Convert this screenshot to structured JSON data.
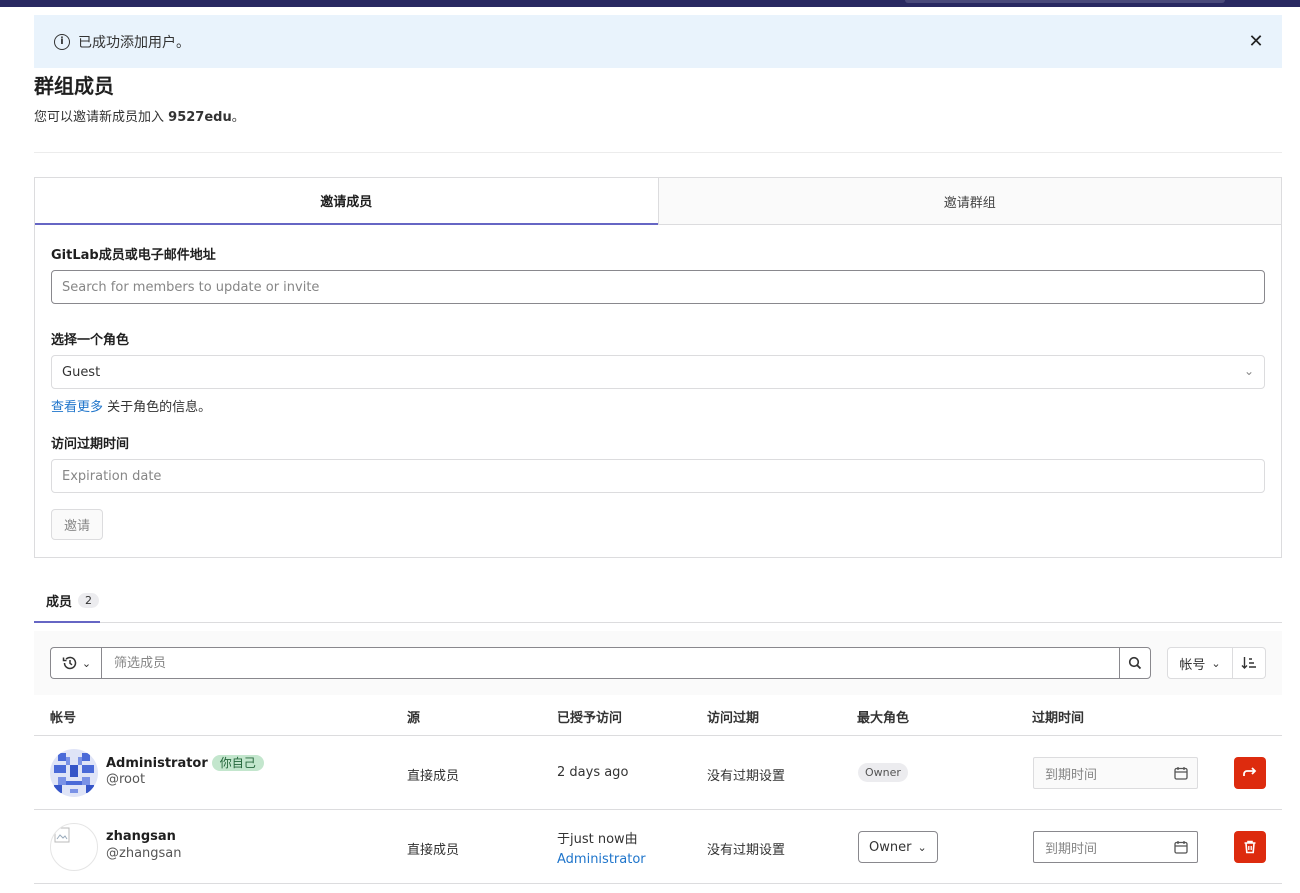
{
  "alert": {
    "icon": "info-icon",
    "message": "已成功添加用户。",
    "close_icon": "close-icon"
  },
  "header": {
    "title": "群组成员",
    "desc_prefix": "您可以邀请新成员加入",
    "group_name": "9527edu",
    "desc_suffix": "。"
  },
  "invite": {
    "tabs": [
      {
        "label": "邀请成员",
        "active": true
      },
      {
        "label": "邀请群组",
        "active": false
      }
    ],
    "member_field_label": "GitLab成员或电子邮件地址",
    "member_field_placeholder": "Search for members to update or invite",
    "role_label": "选择一个角色",
    "role_value": "Guest",
    "help_link": "查看更多",
    "help_text": " 关于角色的信息。",
    "expiry_label": "访问过期时间",
    "expiry_placeholder": "Expiration date",
    "submit_label": "邀请"
  },
  "members_tab": {
    "label": "成员",
    "count": "2"
  },
  "filter": {
    "placeholder": "筛选成员",
    "sort_label": "帐号"
  },
  "table": {
    "headers": [
      "帐号",
      "源",
      "已授予访问",
      "访问过期",
      "最大角色",
      "过期时间"
    ],
    "rows": [
      {
        "name": "Administrator",
        "badge": "你自己",
        "handle": "@root",
        "source": "直接成员",
        "granted_line1": "2 days ago",
        "granted_line2": "",
        "expiry": "没有过期设置",
        "role": "Owner",
        "date_placeholder": "到期时间",
        "action_icon": "leave-arrow-icon"
      },
      {
        "name": "zhangsan",
        "badge": "",
        "handle": "@zhangsan",
        "source": "直接成员",
        "granted_line1": "于just now由",
        "granted_line2": "Administrator",
        "expiry": "没有过期设置",
        "role": "Owner",
        "date_placeholder": "到期时间",
        "action_icon": "trash-icon"
      }
    ]
  },
  "colors": {
    "accent": "#6666c4",
    "danger": "#dd2b0e",
    "link": "#1f75cb",
    "alert_bg": "#e9f3fc"
  }
}
